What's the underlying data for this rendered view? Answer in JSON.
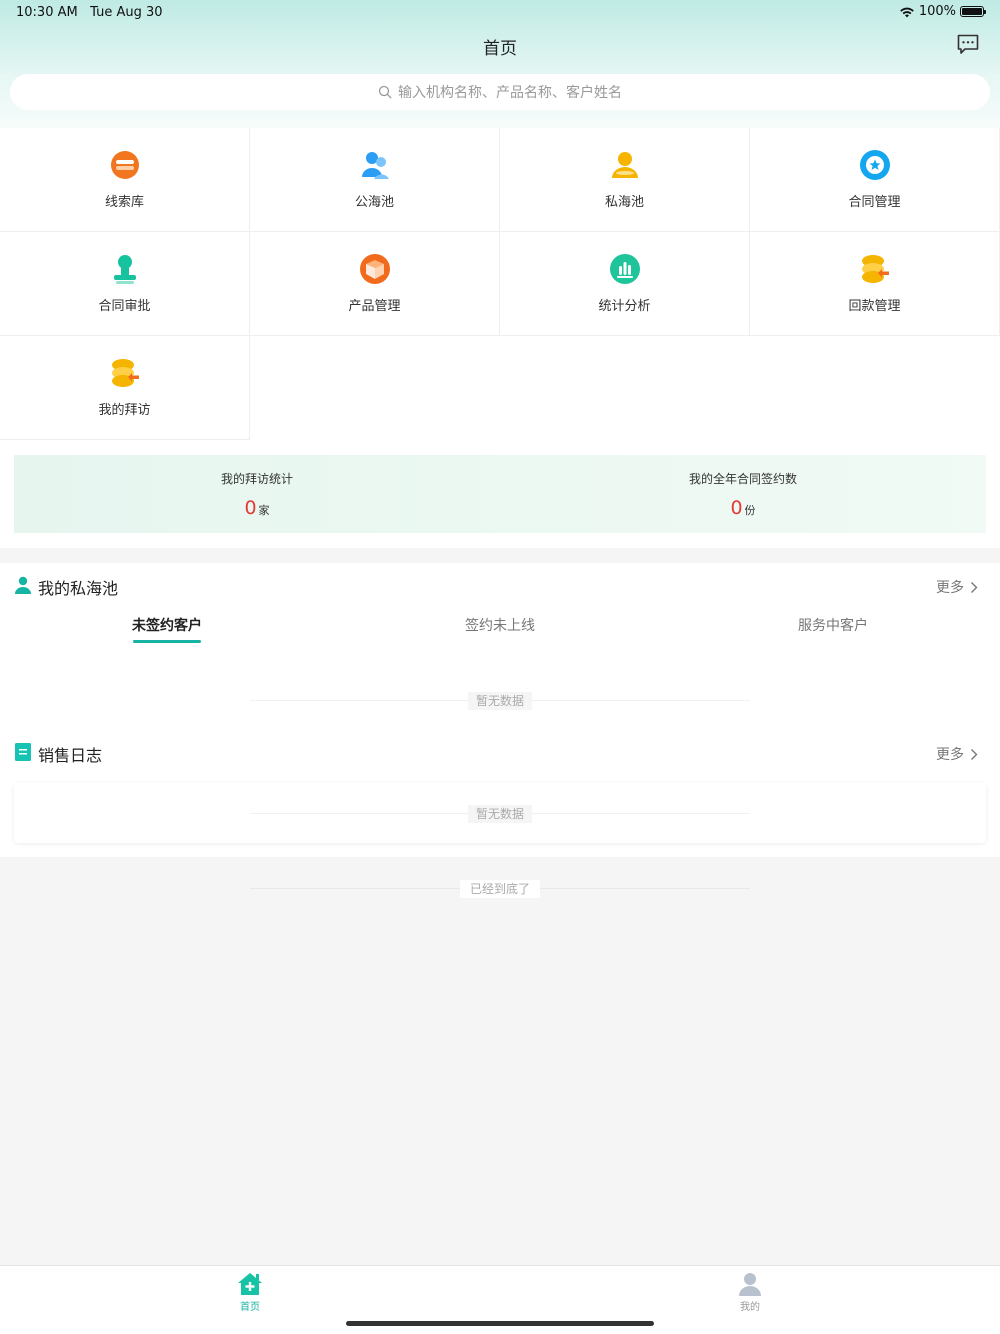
{
  "status_bar": {
    "time": "10:30 AM",
    "date": "Tue Aug 30",
    "battery": "100%"
  },
  "header": {
    "title": "首页",
    "message_icon": "chat-bubble-icon"
  },
  "search": {
    "placeholder": "输入机构名称、产品名称、客户姓名"
  },
  "grid": {
    "items": [
      {
        "label": "线索库",
        "icon": "lead-library-icon",
        "color": "#f2751f"
      },
      {
        "label": "公海池",
        "icon": "public-pool-icon",
        "color": "#2b9df5"
      },
      {
        "label": "私海池",
        "icon": "private-pool-icon",
        "color": "#f6b400"
      },
      {
        "label": "合同管理",
        "icon": "contract-manage-icon",
        "color": "#14a7f0"
      },
      {
        "label": "合同审批",
        "icon": "contract-approve-icon",
        "color": "#17c39e"
      },
      {
        "label": "产品管理",
        "icon": "product-manage-icon",
        "color": "#f26a1b"
      },
      {
        "label": "统计分析",
        "icon": "statistics-icon",
        "color": "#1fc49a"
      },
      {
        "label": "回款管理",
        "icon": "payment-manage-icon",
        "color": "#f5b400"
      },
      {
        "label": "我的拜访",
        "icon": "my-visit-icon",
        "color": "#f5b400"
      }
    ]
  },
  "stats": {
    "visit_label": "我的拜访统计",
    "visit_value": "0",
    "visit_unit": "家",
    "contract_label": "我的全年合同签约数",
    "contract_value": "0",
    "contract_unit": "份"
  },
  "private_pool": {
    "title": "我的私海池",
    "more": "更多",
    "tabs": [
      "未签约客户",
      "签约未上线",
      "服务中客户"
    ],
    "empty": "暂无数据"
  },
  "sales_log": {
    "title": "销售日志",
    "more": "更多",
    "empty": "暂无数据"
  },
  "footer_note": "已经到底了",
  "tabbar": {
    "home": "首页",
    "mine": "我的"
  },
  "colors": {
    "accent": "#17b3a3",
    "stat_value": "#e53935"
  }
}
